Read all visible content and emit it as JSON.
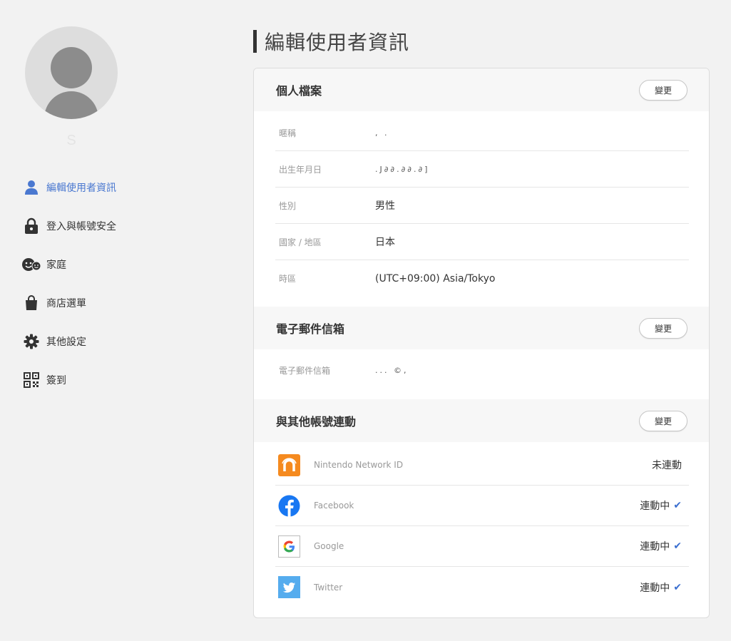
{
  "sidebar": {
    "username": "S",
    "items": [
      {
        "label": "編輯使用者資訊",
        "icon": "user-icon"
      },
      {
        "label": "登入與帳號安全",
        "icon": "lock-icon"
      },
      {
        "label": "家庭",
        "icon": "family-icon"
      },
      {
        "label": "商店選單",
        "icon": "shopping-bag-icon"
      },
      {
        "label": "其他設定",
        "icon": "gear-icon"
      },
      {
        "label": "簽到",
        "icon": "qr-code-icon"
      }
    ],
    "active_color": "#4a78d0"
  },
  "main": {
    "title": "編輯使用者資訊",
    "profile": {
      "title": "個人檔案",
      "change_label": "變更",
      "rows": [
        {
          "label": "暱稱",
          "value": ", ."
        },
        {
          "label": "出生年月日",
          "value": ".J∂∂.∂∂.∂]"
        },
        {
          "label": "性別",
          "value": "男性"
        },
        {
          "label": "國家 / 地區",
          "value": "日本"
        },
        {
          "label": "時區",
          "value": "(UTC+09:00) Asia/Tokyo"
        }
      ]
    },
    "email": {
      "title": "電子郵件信箱",
      "change_label": "變更",
      "rows": [
        {
          "label": "電子郵件信箱",
          "value": "... ©,"
        }
      ]
    },
    "linked": {
      "title": "與其他帳號連動",
      "change_label": "變更",
      "accounts": [
        {
          "name": "Nintendo Network ID",
          "status": "未連動",
          "linked": false,
          "icon": "nintendo-network-icon",
          "color": "#f58a1f"
        },
        {
          "name": "Facebook",
          "status": "連動中",
          "linked": true,
          "icon": "facebook-icon",
          "color": "#1877f2"
        },
        {
          "name": "Google",
          "status": "連動中",
          "linked": true,
          "icon": "google-icon",
          "color": "#4285f4"
        },
        {
          "name": "Twitter",
          "status": "連動中",
          "linked": true,
          "icon": "twitter-icon",
          "color": "#55acee"
        }
      ],
      "check_glyph": "✔"
    }
  }
}
